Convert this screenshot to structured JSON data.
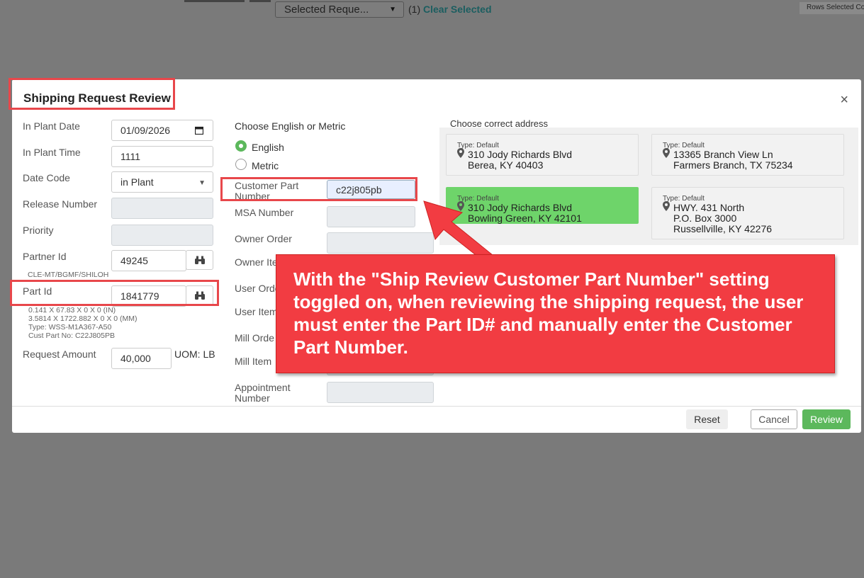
{
  "background": {
    "selected_dropdown": "Selected Reque...",
    "selected_count": "(1)",
    "clear_selected": "Clear Selected",
    "rows_selected": "Rows Selected Co"
  },
  "modal": {
    "title": "Shipping Request Review",
    "close": "×",
    "left": {
      "in_plant_date_label": "In Plant Date",
      "in_plant_date_value": "01/09/2026",
      "in_plant_time_label": "In Plant Time",
      "in_plant_time_value": "1111",
      "date_code_label": "Date Code",
      "date_code_value": "in Plant",
      "release_number_label": "Release Number",
      "priority_label": "Priority",
      "partner_id_label": "Partner Id",
      "partner_id_value": "49245",
      "partner_info": "CLE-MT/BGMF/SHILOH",
      "part_id_label": "Part Id",
      "part_id_value": "1841779",
      "part_details": [
        "0.141 X 67.83 X 0 X 0 (IN)",
        "3.5814 X 1722.882 X 0 X 0 (MM)",
        "Type: WSS-M1A367-A50",
        "Cust Part No: C22J805PB"
      ],
      "request_amount_label": "Request Amount",
      "request_amount_value": "40,000",
      "uom_label": "UOM: LB"
    },
    "middle": {
      "units_heading": "Choose English or Metric",
      "english": "English",
      "metric": "Metric",
      "selected_unit": "English",
      "customer_part_label": "Customer Part Number",
      "customer_part_value": "c22j805pb",
      "msa_label": "MSA Number",
      "owner_order_label": "Owner Order",
      "owner_item_label": "Owner Ite",
      "user_order_label": "User Orde",
      "user_item_label": "User Item",
      "mill_order_label": "Mill Orde",
      "mill_item_label": "Mill Item",
      "appointment_label": "Appointment Number"
    },
    "addresses": {
      "heading": "Choose correct address",
      "cards": [
        {
          "type": "Type: Default",
          "line1": "310 Jody Richards Blvd",
          "line2": "Berea, KY 40403",
          "line3": "",
          "selected": false
        },
        {
          "type": "Type: Default",
          "line1": "13365 Branch View Ln",
          "line2": "Farmers Branch, TX 75234",
          "line3": "",
          "selected": false
        },
        {
          "type": "Type: Default",
          "line1": "310 Jody Richards Blvd",
          "line2": "Bowling Green, KY 42101",
          "line3": "",
          "selected": true
        },
        {
          "type": "Type: Default",
          "line1": "HWY. 431 North",
          "line2": "P.O. Box 3000",
          "line3": "Russellville, KY 42276",
          "selected": false
        }
      ]
    },
    "footer": {
      "reset": "Reset",
      "cancel": "Cancel",
      "review": "Review"
    }
  },
  "annotation": {
    "callout_text": "With the \"Ship Review Customer Part Number\" setting toggled on, when reviewing the shipping request, the user must enter the Part ID# and manually enter the Customer Part Number."
  },
  "colors": {
    "accent_green": "#5cb85c",
    "selected_address": "#6ed46a",
    "annotation_red": "#f23c42",
    "link_teal": "#1b5e60"
  }
}
